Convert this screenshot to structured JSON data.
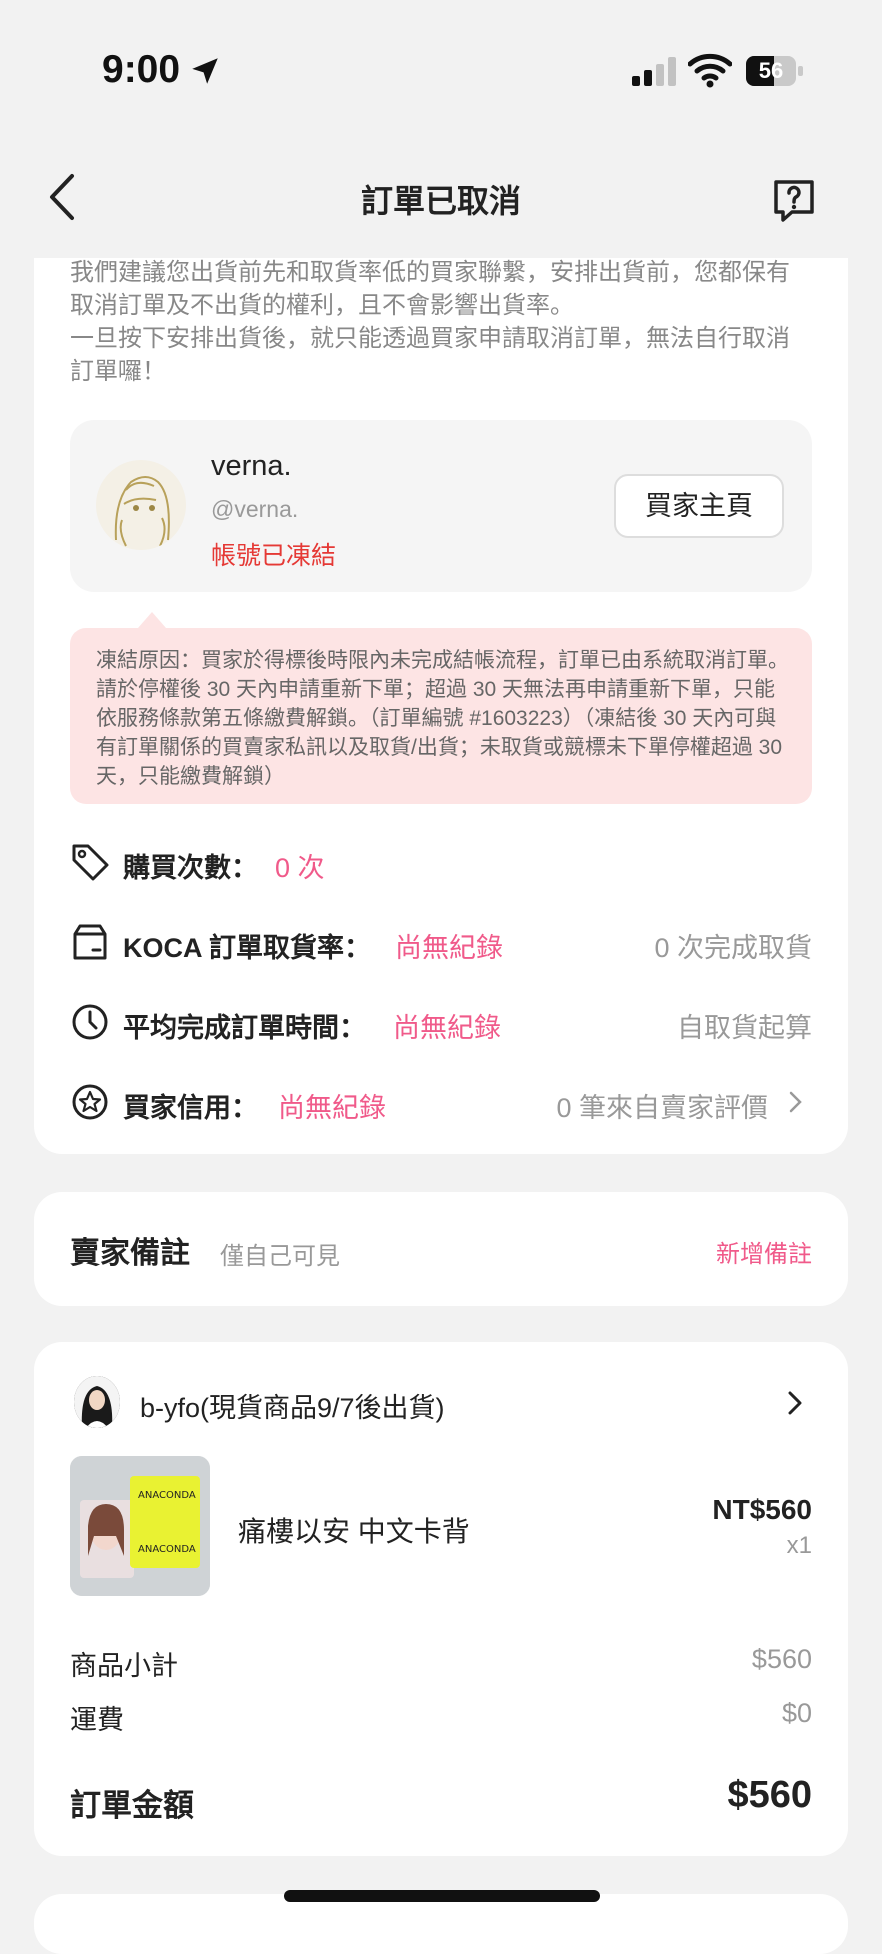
{
  "status_bar": {
    "time": "9:00",
    "battery": "56",
    "battery_level": 0.56
  },
  "nav": {
    "title": "訂單已取消"
  },
  "notice": {
    "line1": "我們建議您出貨前先和取貨率低的買家聯繫，安排出貨前，您都保有取消訂單及不出貨的權利，且不會影響出貨率。",
    "line2": "一旦按下安排出貨後，就只能透過買家申請取消訂單，無法自行取消訂單囉！"
  },
  "buyer": {
    "name": "verna.",
    "handle": "@verna.",
    "status": "帳號已凍結",
    "profile_button": "買家主頁"
  },
  "freeze_notice": {
    "text": "凍結原因：買家於得標後時限內未完成結帳流程，訂單已由系統取消訂單。請於停權後 30 天內申請重新下單；超過 30 天無法再申請重新下單，只能依服務條款第五條繳費解鎖。（訂單編號 #1603223）（凍結後 30 天內可與有訂單關係的買賣家私訊以及取貨/出貨；未取貨或競標未下單停權超過 30 天，只能繳費解鎖）"
  },
  "stats": {
    "purchase": {
      "label": "購買次數：",
      "value": "0 次",
      "right": ""
    },
    "pickup": {
      "label": "KOCA 訂單取貨率：",
      "value": "尚無紀錄",
      "right": "0 次完成取貨"
    },
    "avg_time": {
      "label": "平均完成訂單時間：",
      "value": "尚無紀錄",
      "right": "自取貨起算"
    },
    "credit": {
      "label": "買家信用：",
      "value": "尚無紀錄",
      "right": "0 筆來自賣家評價"
    }
  },
  "seller_note": {
    "title": "賣家備註",
    "subtitle": "僅自己可見",
    "add": "新增備註"
  },
  "order": {
    "seller_name": "b-yfo(現貨商品9/7後出貨)",
    "product_name": "痛樓以安 中文卡背",
    "price": "NT$560",
    "qty": "x1",
    "subtotal_label": "商品小計",
    "subtotal": "$560",
    "shipping_label": "運費",
    "shipping": "$0",
    "total_label": "訂單金額",
    "total": "$560"
  },
  "colors": {
    "accent": "#f05a8a",
    "danger": "#e53935",
    "freeze_bg": "#fde4e4"
  }
}
